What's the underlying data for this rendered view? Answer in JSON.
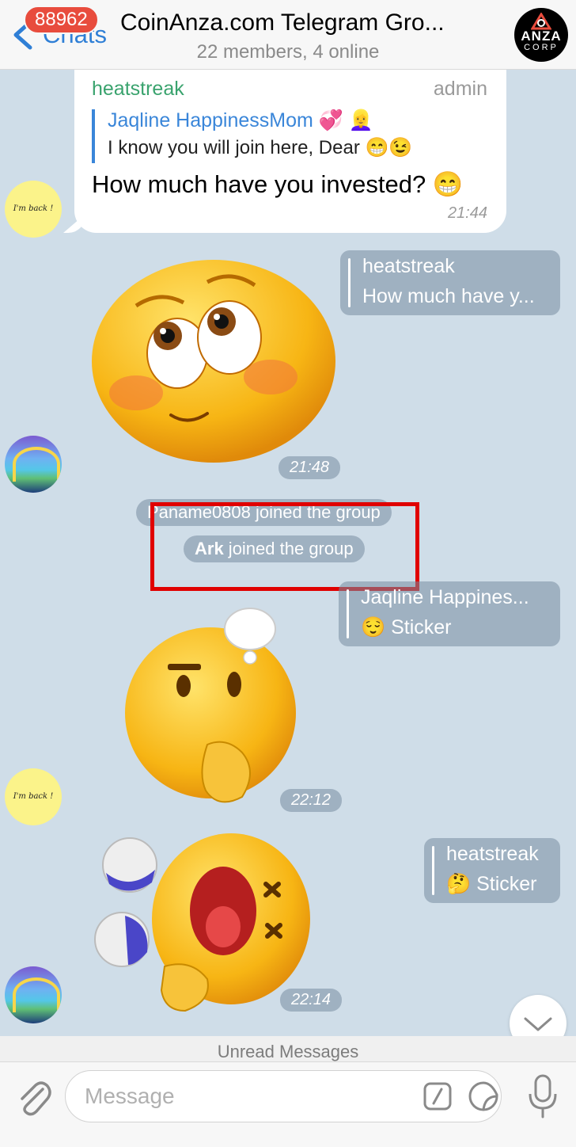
{
  "header": {
    "back_label": "Chats",
    "unread_badge": "88962",
    "title": "CoinAnza.com Telegram Gro...",
    "subtitle": "22 members, 4 online",
    "group_avatar": {
      "main": "ANZA",
      "sub": "CORP"
    }
  },
  "message_1": {
    "sender": "heatstreak",
    "role": "admin",
    "reply_to_name": "Jaqline HappinessMom 💞 👱‍♀️",
    "reply_to_text": "I know you will join here, Dear 😁😉",
    "text": "How much have you invested? 😁",
    "time": "21:44"
  },
  "avatar_text": "I'm back !",
  "sticker_1": {
    "reply_name": "heatstreak",
    "reply_text": "How much have y...",
    "time": "21:48"
  },
  "service": {
    "joined_1": "Paname0808 joined the group",
    "joined_2_name": "Ark",
    "joined_2_text": " joined the group"
  },
  "sticker_2": {
    "reply_name": "Jaqline Happines...",
    "reply_text": "😌 Sticker",
    "time": "22:12"
  },
  "sticker_3": {
    "reply_name": "heatstreak",
    "reply_text": "🤔 Sticker",
    "time": "22:14"
  },
  "unread_label": "Unread Messages",
  "input": {
    "placeholder": "Message"
  },
  "colors": {
    "accent": "#2f7fd6",
    "sender_green": "#3aa36e",
    "badge_red": "#e84c3d",
    "highlight": "#e00000",
    "chat_bg": "#cfdde8"
  },
  "icons": [
    "back-chevron-icon",
    "attach-icon",
    "command-icon",
    "sticker-icon",
    "mic-icon",
    "chevron-down-icon"
  ]
}
